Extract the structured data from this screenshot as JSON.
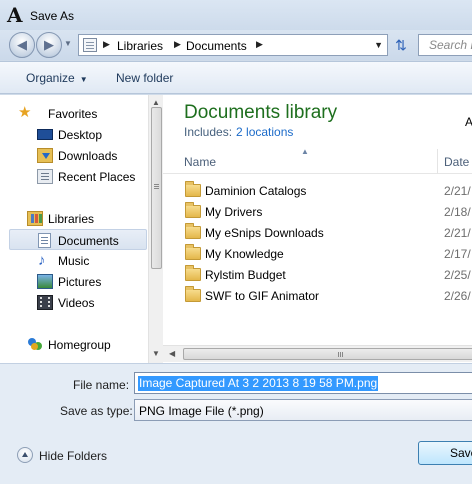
{
  "window": {
    "title": "Save As",
    "app_logo_letter": "A"
  },
  "address_bar": {
    "breadcrumbs": [
      "Libraries",
      "Documents"
    ],
    "search_placeholder": "Search D"
  },
  "toolbar": {
    "organize_label": "Organize",
    "new_folder_label": "New folder"
  },
  "nav_pane": {
    "favorites": {
      "label": "Favorites",
      "items": [
        {
          "label": "Desktop",
          "icon": "desktop-icon"
        },
        {
          "label": "Downloads",
          "icon": "downloads-icon"
        },
        {
          "label": "Recent Places",
          "icon": "recent-places-icon"
        }
      ]
    },
    "libraries": {
      "label": "Libraries",
      "items": [
        {
          "label": "Documents",
          "icon": "documents-icon",
          "selected": true
        },
        {
          "label": "Music",
          "icon": "music-icon"
        },
        {
          "label": "Pictures",
          "icon": "pictures-icon"
        },
        {
          "label": "Videos",
          "icon": "videos-icon"
        }
      ]
    },
    "homegroup": {
      "label": "Homegroup"
    }
  },
  "content": {
    "library_title": "Documents library",
    "includes_label": "Includes:",
    "includes_link": "2 locations",
    "arrange_label": "A",
    "columns": {
      "name": "Name",
      "date": "Date"
    },
    "files": [
      {
        "name": "Daminion Catalogs",
        "date": "2/21/"
      },
      {
        "name": "My Drivers",
        "date": "2/18/"
      },
      {
        "name": "My eSnips Downloads",
        "date": "2/21/"
      },
      {
        "name": "My Knowledge",
        "date": "2/17/"
      },
      {
        "name": "Rylstim Budget",
        "date": "2/25/"
      },
      {
        "name": "SWF to GIF Animator",
        "date": "2/26/"
      }
    ]
  },
  "form": {
    "file_name_label": "File name:",
    "file_name_value": "Image Captured At 3 2 2013 8 19 58 PM.png",
    "save_type_label": "Save as type:",
    "save_type_value": "PNG Image File (*.png)"
  },
  "footer": {
    "hide_folders_label": "Hide Folders",
    "save_label": "Save"
  },
  "colors": {
    "library_title": "#1e6f1e",
    "link": "#1c6bc9",
    "selection": "#3399ff",
    "window_chrome": "#cfdbe9"
  }
}
